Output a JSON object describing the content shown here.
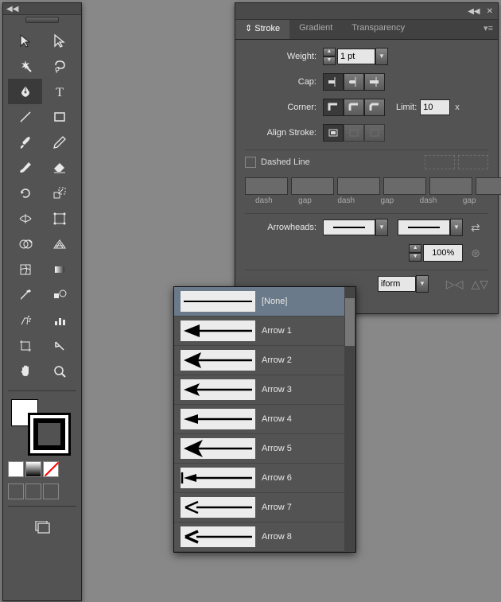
{
  "toolbar": {
    "tools": [
      [
        "selection-tool",
        "direct-selection-tool"
      ],
      [
        "magic-wand-tool",
        "lasso-tool"
      ],
      [
        "pen-tool",
        "type-tool"
      ],
      [
        "line-tool",
        "rectangle-tool"
      ],
      [
        "paintbrush-tool",
        "pencil-tool"
      ],
      [
        "blob-brush-tool",
        "eraser-tool"
      ],
      [
        "rotate-tool",
        "scale-tool"
      ],
      [
        "width-tool",
        "free-transform-tool"
      ],
      [
        "shape-builder-tool",
        "perspective-grid-tool"
      ],
      [
        "mesh-tool",
        "gradient-tool"
      ],
      [
        "eyedropper-tool",
        "blend-tool"
      ],
      [
        "symbol-sprayer-tool",
        "column-graph-tool"
      ],
      [
        "artboard-tool",
        "slice-tool"
      ],
      [
        "hand-tool",
        "zoom-tool"
      ]
    ],
    "selected": "pen-tool"
  },
  "tabs": {
    "t1": "Stroke",
    "t2": "Gradient",
    "t3": "Transparency"
  },
  "stroke": {
    "weight_lbl": "Weight:",
    "weight_val": "1 pt",
    "cap_lbl": "Cap:",
    "corner_lbl": "Corner:",
    "limit_lbl": "Limit:",
    "limit_val": "10",
    "limit_x": "x",
    "align_lbl": "Align Stroke:",
    "dashed_lbl": "Dashed Line",
    "dash": "dash",
    "gap": "gap",
    "arrow_lbl": "Arrowheads:",
    "scale_val": "100%",
    "profile_val": "iform"
  },
  "arrow_options": [
    {
      "label": "[None]",
      "type": "none"
    },
    {
      "label": "Arrow 1",
      "type": "a1"
    },
    {
      "label": "Arrow 2",
      "type": "a2"
    },
    {
      "label": "Arrow 3",
      "type": "a3"
    },
    {
      "label": "Arrow 4",
      "type": "a4"
    },
    {
      "label": "Arrow 5",
      "type": "a5"
    },
    {
      "label": "Arrow 6",
      "type": "a6"
    },
    {
      "label": "Arrow 7",
      "type": "a7"
    },
    {
      "label": "Arrow 8",
      "type": "a8"
    }
  ],
  "arrow_selected": 0
}
